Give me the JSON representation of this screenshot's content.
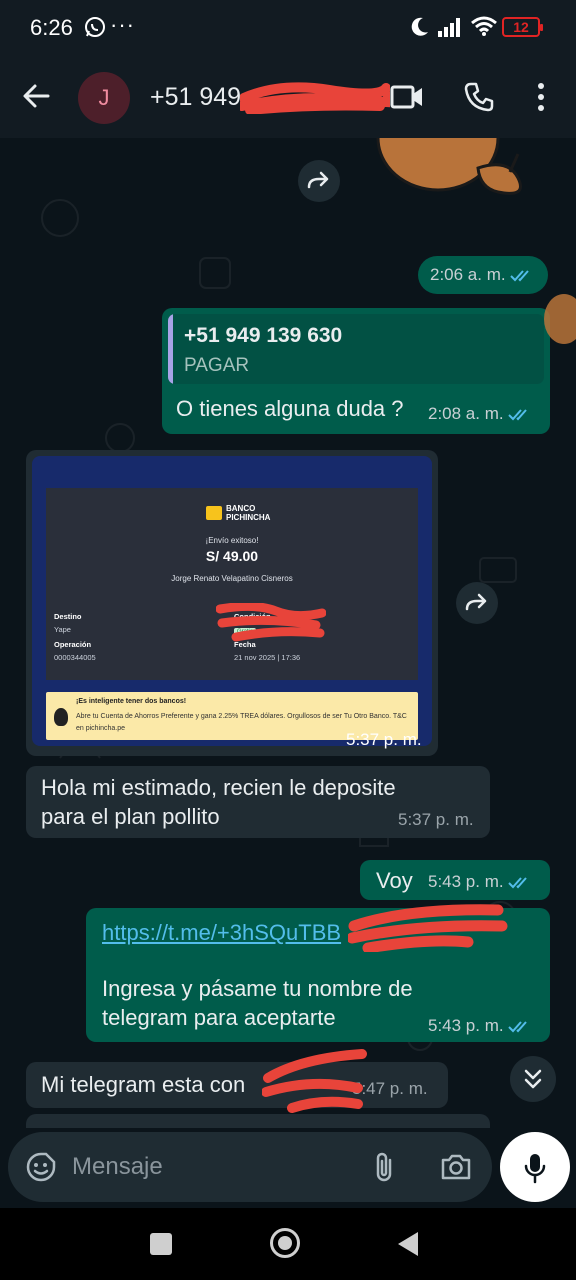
{
  "status_bar": {
    "time": "6:26",
    "dots": "···",
    "battery": "12"
  },
  "header": {
    "contact_name": "+51 949"
  },
  "messages": [
    {
      "id": "m1",
      "direction": "outgoing",
      "type": "sticker",
      "time": "2:06 a. m."
    },
    {
      "id": "m2",
      "direction": "outgoing",
      "type": "reply",
      "quoted_title": "+51 949 139 630",
      "quoted_subtitle": "PAGAR",
      "text": "O tienes alguna duda ?",
      "time": "2:08 a. m."
    },
    {
      "id": "m3",
      "direction": "incoming",
      "type": "image",
      "time": "5:37 p. m.",
      "receipt": {
        "bank": "BANCO PICHINCHA",
        "status": "¡Envío exitoso!",
        "amount": "S/ 49.00",
        "name": "Jorge Renato Velapatino Cisneros",
        "destino_label": "Destino",
        "destino_value": "Yape",
        "condicion_label": "Condición",
        "condicion_value": "Gratis",
        "operacion_label": "Operación",
        "operacion_value": "0000344005",
        "fecha_label": "Fecha",
        "fecha_value": "21 nov 2025 | 17:36",
        "banner_title": "¡Es inteligente tener dos bancos!",
        "banner_text": "Abre tu Cuenta de Ahorros Preferente y gana 2.25% TREA dólares. Orgullosos de ser Tu Otro Banco. T&C en pichincha.pe"
      }
    },
    {
      "id": "m4",
      "direction": "incoming",
      "type": "text",
      "text_line1": "Hola mi estimado, recien le deposite",
      "text_line2": "para el plan pollito",
      "time": "5:37 p. m."
    },
    {
      "id": "m5",
      "direction": "outgoing",
      "type": "text",
      "text": "Voy",
      "time": "5:43 p. m."
    },
    {
      "id": "m6",
      "direction": "outgoing",
      "type": "link",
      "link": "https://t.me/+3hSQuTBB",
      "text_line1": "Ingresa y pásame tu nombre de",
      "text_line2": "telegram para aceptarte",
      "time": "5:43 p. m."
    },
    {
      "id": "m7",
      "direction": "incoming",
      "type": "text",
      "text": "Mi telegram esta con",
      "time": "5:47 p. m."
    }
  ],
  "composer": {
    "placeholder": "Mensaje"
  },
  "icons": {
    "status": [
      "whatsapp-icon",
      "moon-icon",
      "signal-icon",
      "wifi-icon",
      "battery-icon"
    ],
    "header": [
      "back-arrow-icon",
      "video-call-icon",
      "phone-icon",
      "more-vert-icon"
    ],
    "composer": [
      "emoji-icon",
      "attach-icon",
      "camera-icon",
      "mic-icon"
    ],
    "nav": [
      "recents-icon",
      "home-icon",
      "back-icon"
    ]
  },
  "colors": {
    "outgoing_bubble": "#005c4b",
    "incoming_bubble": "#202c33",
    "background": "#0b141a",
    "read_ticks": "#53bdeb",
    "link": "#53bdeb"
  }
}
